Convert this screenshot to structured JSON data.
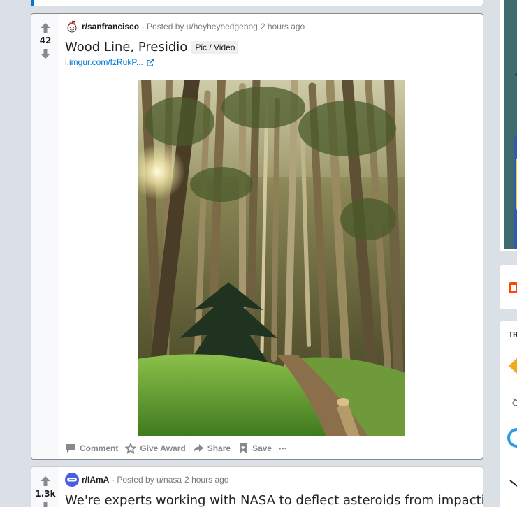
{
  "post1": {
    "score": "42",
    "subreddit": "r/sanfrancisco",
    "posted_by": "Posted by u/heyheyhedgehog",
    "time": "2 hours ago",
    "title": "Wood Line, Presidio",
    "flair": "Pic / Video",
    "link": "i.imgur.com/fzRukP...",
    "actions": {
      "comment": "Comment",
      "award": "Give Award",
      "share": "Share",
      "save": "Save",
      "more": "•••"
    }
  },
  "post2": {
    "score": "1.3k",
    "subreddit": "r/IAmA",
    "posted_by": "Posted by u/nasa",
    "time": "2 hours ago",
    "title": "We're experts working with NASA to deflect asteroids from impacting"
  },
  "sidebar": {
    "trending_label": "TR"
  },
  "colors": {
    "upvote": "#878a8c",
    "link": "#0079d3",
    "background": "#dae0e6"
  }
}
